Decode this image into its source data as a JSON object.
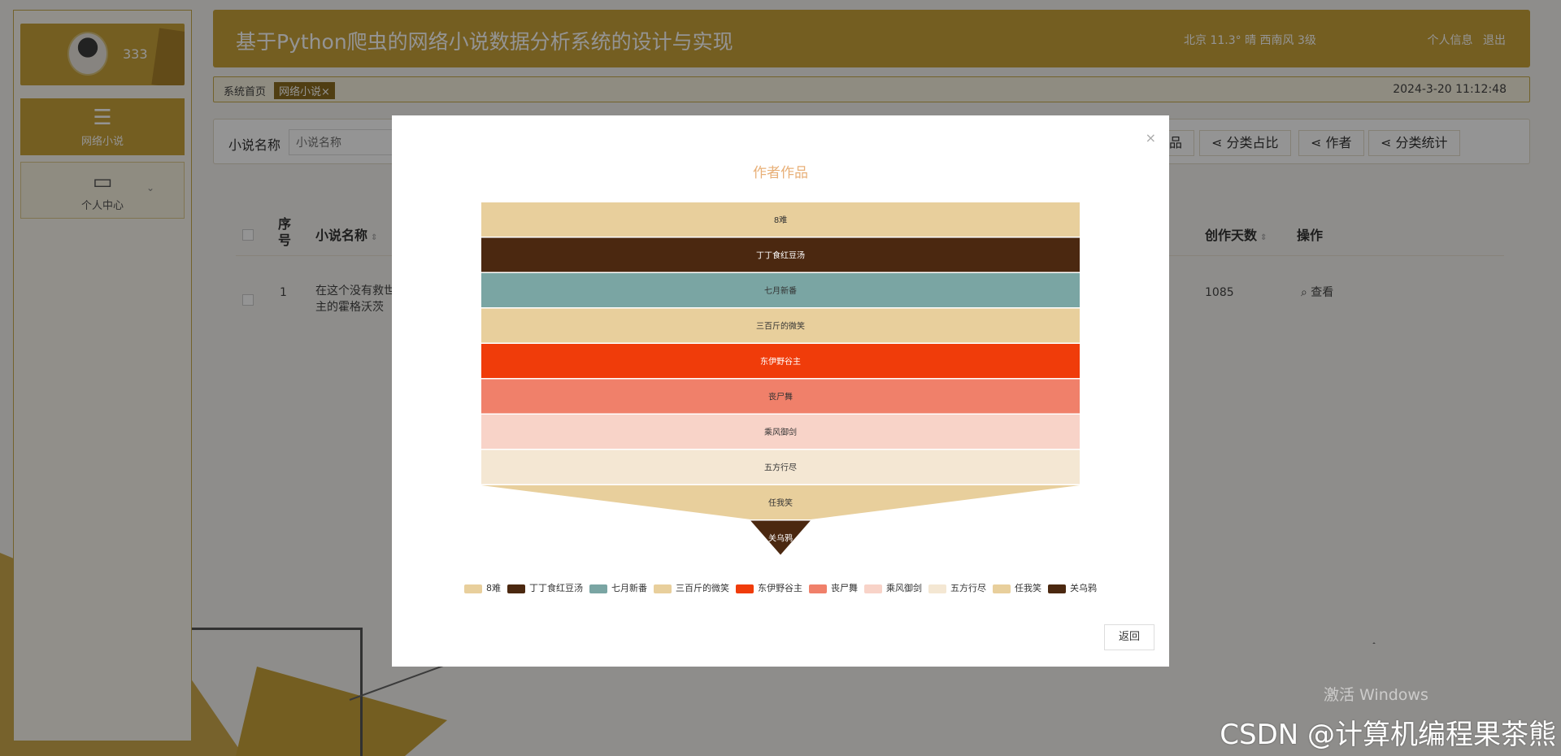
{
  "header": {
    "title": "基于Python爬虫的网络小说数据分析系统的设计与实现",
    "weather": "北京  11.3°  晴  西南风  3级",
    "profile_link": "个人信息",
    "logout_link": "退出"
  },
  "sidebar": {
    "username": "333",
    "items": [
      {
        "label": "网络小说"
      },
      {
        "label": "个人中心"
      }
    ]
  },
  "tabs": {
    "home": "系统首页",
    "current": "网络小说×",
    "datetime": "2024-3-20 11:12:48"
  },
  "search": {
    "label": "小说名称",
    "placeholder": "小说名称",
    "buttons": [
      "品",
      "分类占比",
      "作者",
      "分类统计"
    ]
  },
  "table": {
    "headers": [
      "序号",
      "小说名称",
      "创作天数",
      "操作"
    ],
    "row": {
      "index": "1",
      "name_line1": "在这个没有救世",
      "name_line2": "主的霍格沃茨",
      "days": "1085",
      "action": "查看"
    }
  },
  "modal": {
    "close": "×",
    "back_button": "返回"
  },
  "chart_data": {
    "type": "funnel",
    "title": "作者作品",
    "categories": [
      "8难",
      "丁丁食红豆汤",
      "七月新番",
      "三百斤的微笑",
      "东伊野谷主",
      "丧尸舞",
      "乘风御剑",
      "五方行尽",
      "任我笑",
      "关乌鸦"
    ],
    "values": [
      10,
      10,
      10,
      10,
      10,
      10,
      10,
      10,
      10,
      1
    ],
    "colors": [
      "#e8cf9c",
      "#4b2810",
      "#7aa5a3",
      "#e8cf9c",
      "#f03c0a",
      "#f0806a",
      "#f8d3c8",
      "#f4e7d3",
      "#e8cf9c",
      "#4b2810"
    ],
    "legend": "bottom"
  },
  "watermarks": {
    "windows": "激活 Windows",
    "csdn": "CSDN @计算机编程果茶熊"
  }
}
